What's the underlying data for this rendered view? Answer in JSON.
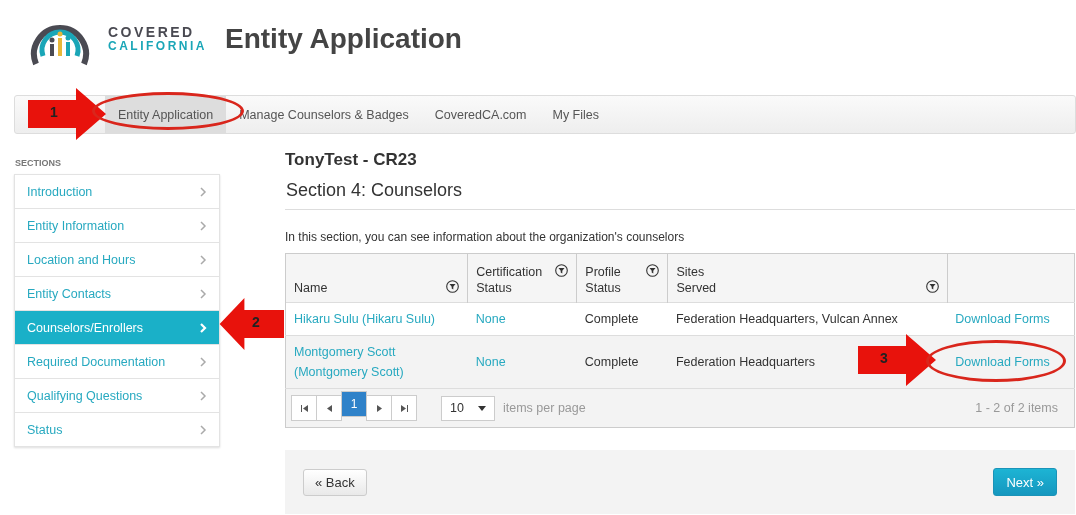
{
  "header": {
    "logo_line1": "COVERED",
    "logo_line2": "CALIFORNIA",
    "title": "Entity Application"
  },
  "nav": [
    {
      "label": "Entity Application",
      "selected": true
    },
    {
      "label": "Manage Counselors & Badges",
      "selected": false
    },
    {
      "label": "CoveredCA.com",
      "selected": false
    },
    {
      "label": "My Files",
      "selected": false
    }
  ],
  "sidebar": {
    "heading": "SECTIONS",
    "items": [
      {
        "label": "Introduction",
        "selected": false
      },
      {
        "label": "Entity Information",
        "selected": false
      },
      {
        "label": "Location and Hours",
        "selected": false
      },
      {
        "label": "Entity Contacts",
        "selected": false
      },
      {
        "label": "Counselors/Enrollers",
        "selected": true
      },
      {
        "label": "Required Documentation",
        "selected": false
      },
      {
        "label": "Qualifying Questions",
        "selected": false
      },
      {
        "label": "Status",
        "selected": false
      }
    ]
  },
  "main": {
    "entity": "TonyTest - CR23",
    "section_title": "Section 4: Counselors",
    "intro": "In this section, you can see information about the organization's counselors"
  },
  "table": {
    "columns": [
      {
        "label": "Name",
        "filter": true
      },
      {
        "label": "Certification Status",
        "filter": true
      },
      {
        "label": "Profile Status",
        "filter": true
      },
      {
        "label": "Sites Served",
        "filter": true
      },
      {
        "filter": false
      }
    ],
    "rows": [
      {
        "name": "Hikaru Sulu (Hikaru Sulu)",
        "certification": "None",
        "profile": "Complete",
        "sites": "Federation Headquarters, Vulcan Annex",
        "action": "Download Forms"
      },
      {
        "name": "Montgomery Scott (Montgomery Scott)",
        "certification": "None",
        "profile": "Complete",
        "sites": "Federation Headquarters",
        "action": "Download Forms"
      }
    ]
  },
  "pager": {
    "pages": [
      {
        "label": "1",
        "selected": true
      }
    ],
    "page_size": "10",
    "page_size_label": "items per page",
    "summary": "1 - 2 of 2 items"
  },
  "buttons": {
    "back": "« Back",
    "next": "Next »"
  },
  "annotations": [
    {
      "label": "1",
      "kind": "arrow-right"
    },
    {
      "kind": "ellipse"
    },
    {
      "label": "2",
      "kind": "arrow-left"
    },
    {
      "label": "3",
      "kind": "arrow-right"
    },
    {
      "kind": "ellipse"
    }
  ]
}
